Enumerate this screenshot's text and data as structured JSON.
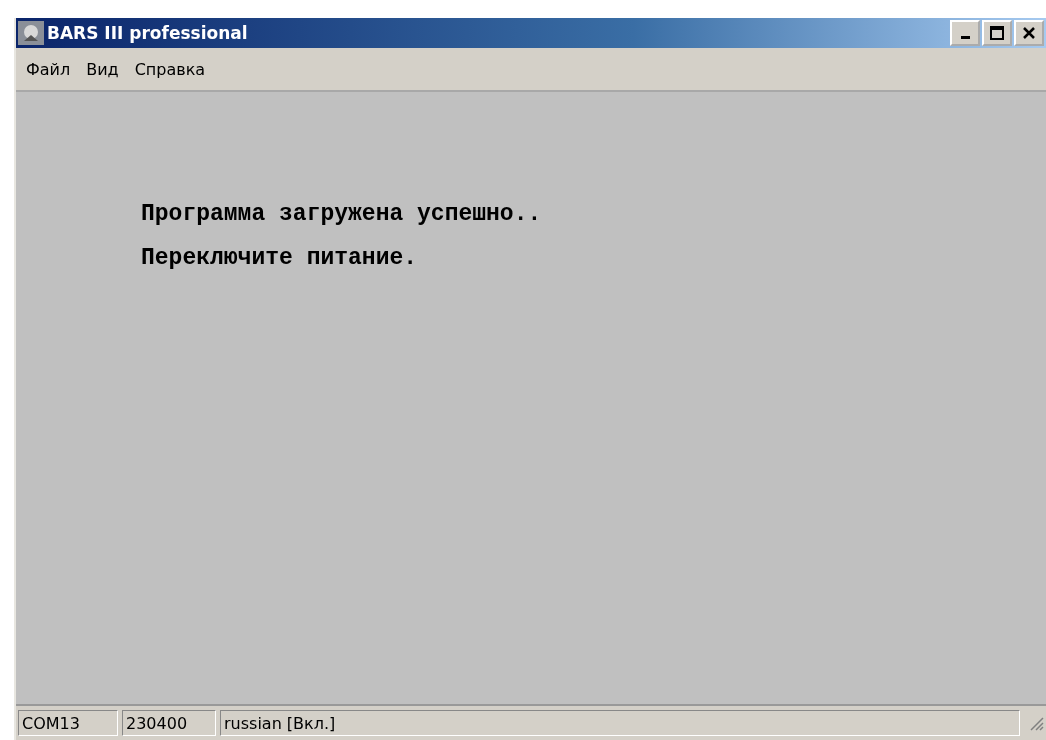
{
  "window": {
    "title": "BARS III professional"
  },
  "menu": [
    "Файл",
    "Вид",
    "Справка"
  ],
  "messages": [
    "Программа загружена успешно..",
    "Переключите питание."
  ],
  "status_bar": [
    "COM13",
    "230400",
    "russian [Вкл.]"
  ]
}
